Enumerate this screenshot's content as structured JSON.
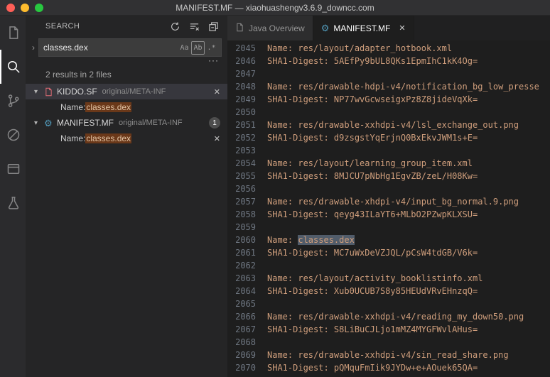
{
  "colors": {
    "accent": "#519aba",
    "editor_text": "#cf9e7c",
    "find_match_bg": "#515c6a",
    "sidebar_match_bg": "#6a3819",
    "selected_row_bg": "#37373d",
    "kiddo_file_icon": "#e06c75"
  },
  "icons": {
    "close": "✕",
    "chevron_expanded": "▾",
    "chevron_collapsed": "›",
    "more": "···",
    "gear": "⚙"
  },
  "titlebar": {
    "title": "MANIFEST.MF — xiaohuashengv3.6.9_downcc.com",
    "traffic_lights": [
      "#ff5f57",
      "#febc2e",
      "#28c840"
    ]
  },
  "activity_bar": {
    "items": [
      {
        "icon": "explorer-icon",
        "active": false
      },
      {
        "icon": "search-icon",
        "active": true
      },
      {
        "icon": "source-control-icon",
        "active": false
      },
      {
        "icon": "circle-slash-icon",
        "active": false
      },
      {
        "icon": "window-icon",
        "active": false
      },
      {
        "icon": "beaker-icon",
        "active": false
      }
    ]
  },
  "search_panel": {
    "title": "SEARCH",
    "query": "classes.dex",
    "options": [
      {
        "name": "match-case",
        "glyph": "Aa"
      },
      {
        "name": "whole-word",
        "glyph": "Ab"
      },
      {
        "name": "regex",
        "glyph": ".*"
      }
    ],
    "results_summary": "2 results in 2 files",
    "files": [
      {
        "name": "KIDDO.SF",
        "path": "original/META-INF",
        "selected": true,
        "matches": [
          {
            "prefix": "Name: ",
            "match": "classes.dex"
          }
        ]
      },
      {
        "name": "MANIFEST.MF",
        "path": "original/META-INF",
        "badge": "1",
        "matches": [
          {
            "prefix": "Name: ",
            "match": "classes.dex"
          }
        ]
      }
    ]
  },
  "tabs": [
    {
      "label": "Java Overview",
      "active": false
    },
    {
      "label": "MANIFEST.MF",
      "active": true
    }
  ],
  "editor": {
    "lines": [
      {
        "num": "2045",
        "text": "Name: res/layout/adapter_hotbook.xml"
      },
      {
        "num": "2046",
        "text": "SHA1-Digest: 5AEfPy9bUL8QKs1EpmIhC1kK4Og="
      },
      {
        "num": "2047",
        "text": ""
      },
      {
        "num": "2048",
        "text": "Name: res/drawable-hdpi-v4/notification_bg_low_presse"
      },
      {
        "num": "2049",
        "text": "SHA1-Digest: NP77wvGcwseigxPz8Z8jideVqXk="
      },
      {
        "num": "2050",
        "text": ""
      },
      {
        "num": "2051",
        "text": "Name: res/drawable-xxhdpi-v4/lsl_exchange_out.png"
      },
      {
        "num": "2052",
        "text": "SHA1-Digest: d9zsgstYqErjnQ0BxEkvJWM1s+E="
      },
      {
        "num": "2053",
        "text": ""
      },
      {
        "num": "2054",
        "text": "Name: res/layout/learning_group_item.xml"
      },
      {
        "num": "2055",
        "text": "SHA1-Digest: 8MJCU7pNbHg1EgvZB/zeL/H08Kw="
      },
      {
        "num": "2056",
        "text": ""
      },
      {
        "num": "2057",
        "text": "Name: res/drawable-xhdpi-v4/input_bg_normal.9.png"
      },
      {
        "num": "2058",
        "text": "SHA1-Digest: qeyg43ILaYT6+MLbO2PZwpKLXSU="
      },
      {
        "num": "2059",
        "text": ""
      },
      {
        "num": "2060",
        "before": "Name: ",
        "match": "classes.dex",
        "after": ""
      },
      {
        "num": "2061",
        "text": "SHA1-Digest: MC7uWxDeVZJQL/pCsW4tdGB/V6k="
      },
      {
        "num": "2062",
        "text": ""
      },
      {
        "num": "2063",
        "text": "Name: res/layout/activity_booklistinfo.xml"
      },
      {
        "num": "2064",
        "text": "SHA1-Digest: Xub0UCUB7S8y85HEUdVRvEHnzqQ="
      },
      {
        "num": "2065",
        "text": ""
      },
      {
        "num": "2066",
        "text": "Name: res/drawable-xxhdpi-v4/reading_my_down50.png"
      },
      {
        "num": "2067",
        "text": "SHA1-Digest: S8LiBuCJLjo1mMZ4MYGFWvlAHus="
      },
      {
        "num": "2068",
        "text": ""
      },
      {
        "num": "2069",
        "text": "Name: res/drawable-xxhdpi-v4/sin_read_share.png"
      },
      {
        "num": "2070",
        "text": "SHA1-Digest: pQMquFmIik9JYDw+e+AOuek65QA="
      }
    ]
  }
}
